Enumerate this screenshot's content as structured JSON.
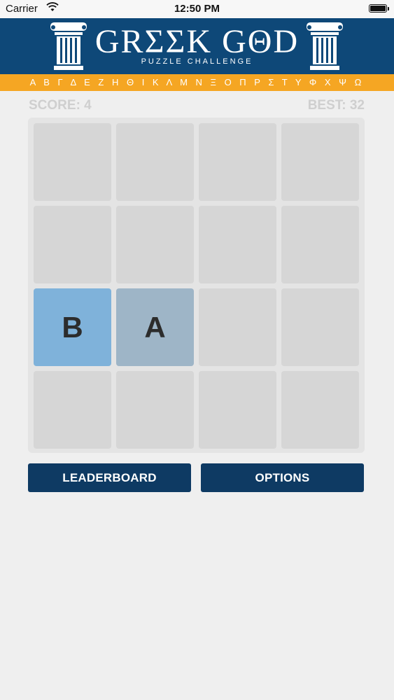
{
  "status_bar": {
    "carrier": "Carrier",
    "time": "12:50 PM",
    "wifi_icon": "wifi-icon",
    "battery_icon": "battery-icon"
  },
  "header": {
    "title": "GRΣΣK GΘD",
    "subtitle": "PUZZLE CHALLENGE",
    "alphabet": "Α Β Γ Δ Ε Ζ Η Θ Ι Κ Λ Μ Ν Ξ Ο Π Ρ Σ Τ Υ Φ Χ Ψ Ω",
    "colors": {
      "banner": "#0e4878",
      "strip": "#f5a623"
    }
  },
  "scores": {
    "score": "SCORE: 4",
    "best": "BEST: 32"
  },
  "board": {
    "rows": [
      [
        "",
        "",
        "",
        ""
      ],
      [
        "",
        "",
        "",
        ""
      ],
      [
        "B",
        "A",
        "",
        ""
      ],
      [
        "",
        "",
        "",
        ""
      ]
    ],
    "colors": {
      "empty": "#d6d6d6",
      "B": "#7fb2da",
      "A": "#9eb5c7"
    }
  },
  "buttons": {
    "leaderboard": "LEADERBOARD",
    "options": "OPTIONS"
  }
}
